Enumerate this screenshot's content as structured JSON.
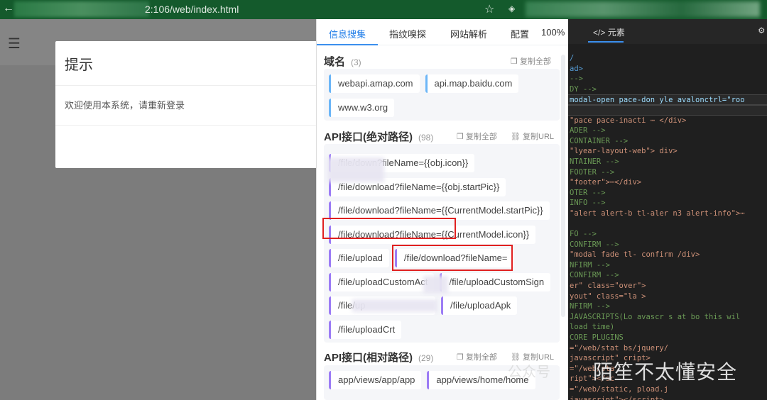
{
  "browser": {
    "url": "2:106/web/index.html",
    "back_icon": "arrow-left",
    "star_icon": "star"
  },
  "page": {
    "menu_icon": "hamburger"
  },
  "modal": {
    "title": "提示",
    "message": "欢迎使用本系统，请重新登录"
  },
  "panel": {
    "tabs": [
      "信息搜集",
      "指纹嗅探",
      "网站解析",
      "配置"
    ],
    "zoom": "100%",
    "domains": {
      "title": "域名",
      "count": "(3)",
      "copy_all": "复制全部",
      "items": [
        "webapi.amap.com",
        "api.map.baidu.com",
        "www.w3.org"
      ]
    },
    "api_abs": {
      "title": "API接口(绝对路径)",
      "count": "(98)",
      "copy_all": "复制全部",
      "copy_url": "复制URL",
      "items": [
        "/file/down?fileName={{obj.icon}}",
        "/file/download?fileName={{obj.startPic}}",
        "/file/download?fileName={{CurrentModel.startPic}}",
        "/file/download?fileName={{CurrentModel.icon}}",
        "/file/upload",
        "/file/download?fileName=",
        "/file/uploadCustomAct",
        "/file/uploadCustomSign",
        "/file/up",
        "/file/uploadApk",
        "/file/uploadCrt"
      ]
    },
    "api_rel": {
      "title": "API接口(相对路径)",
      "count": "(29)",
      "copy_all": "复制全部",
      "copy_url": "复制URL",
      "items": [
        "app/views/app/app",
        "app/views/home/home"
      ]
    }
  },
  "devtools": {
    "tab": "元素",
    "lines": [
      {
        "t": "/",
        "k": "t"
      },
      {
        "t": "ad>",
        "k": "t"
      },
      {
        "t": " -->",
        "k": "c"
      },
      {
        "t": "DY -->",
        "k": "c"
      },
      {
        "t": " modal-open pace-don   yle avalonctrl=\"roo",
        "k": "hl"
      },
      {
        "t": "",
        "k": "hl"
      },
      {
        "t": "\"pace  pace-inacti    ⋯ </div>",
        "k": "s"
      },
      {
        "t": "ADER -->",
        "k": "c"
      },
      {
        "t": "CONTAINER -->",
        "k": "c"
      },
      {
        "t": "\"lyear-layout-web\">    div>",
        "k": "s"
      },
      {
        "t": "NTAINER -->",
        "k": "c"
      },
      {
        "t": "FOOTER -->",
        "k": "c"
      },
      {
        "t": "\"footer\">⋯</div>",
        "k": "s"
      },
      {
        "t": "OTER -->",
        "k": "c"
      },
      {
        "t": "INFO -->",
        "k": "c"
      },
      {
        "t": "\"alert alert-b    tl-aler    n3 alert-info\">⋯",
        "k": "s"
      },
      {
        "t": "",
        "k": "t"
      },
      {
        "t": "FO -->",
        "k": "c"
      },
      {
        "t": "CONFIRM -->",
        "k": "c"
      },
      {
        "t": "\"modal fade tl-     confirm    /div>",
        "k": "s"
      },
      {
        "t": "NFIRM -->",
        "k": "c"
      },
      {
        "t": "CONFIRM -->",
        "k": "c"
      },
      {
        "t": "er\" class=\"over\">",
        "k": "s"
      },
      {
        "t": "yout\" class=\"la       >",
        "k": "s"
      },
      {
        "t": "NFIRM -->",
        "k": "c"
      },
      {
        "t": "JAVASCRIPTS(Lo    avascr   s at bo     this wil",
        "k": "c"
      },
      {
        "t": " load time)",
        "k": "c"
      },
      {
        "t": "CORE PLUGINS",
        "k": "c"
      },
      {
        "t": "=\"/web/stat    bs/jquery/",
        "k": "s"
      },
      {
        "t": "javascript\"   cript>",
        "k": "s"
      },
      {
        "t": "=\"/web/sta",
        "k": "s"
      },
      {
        "t": "ript\"></sc",
        "k": "s"
      },
      {
        "t": "=\"/web/static,            pload.j",
        "k": "s"
      },
      {
        "t": "javascript\"></script>",
        "k": "s"
      }
    ]
  },
  "watermark": {
    "text": "陌笙不太懂安全",
    "channel": "公众号"
  }
}
